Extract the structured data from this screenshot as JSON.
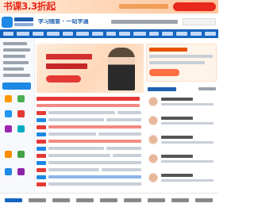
{
  "promo": {
    "headline": "书课3.3折起"
  },
  "header": {
    "slogan": "学习随意 · 一站学通"
  },
  "colors": {
    "brand_blue": "#1565c0",
    "accent_red": "#e8291c",
    "promo_bg": "#ffd2b0"
  },
  "icons": [
    "logo-icon",
    "book-icon",
    "calendar-icon",
    "document-icon",
    "chart-icon",
    "search-icon"
  ]
}
